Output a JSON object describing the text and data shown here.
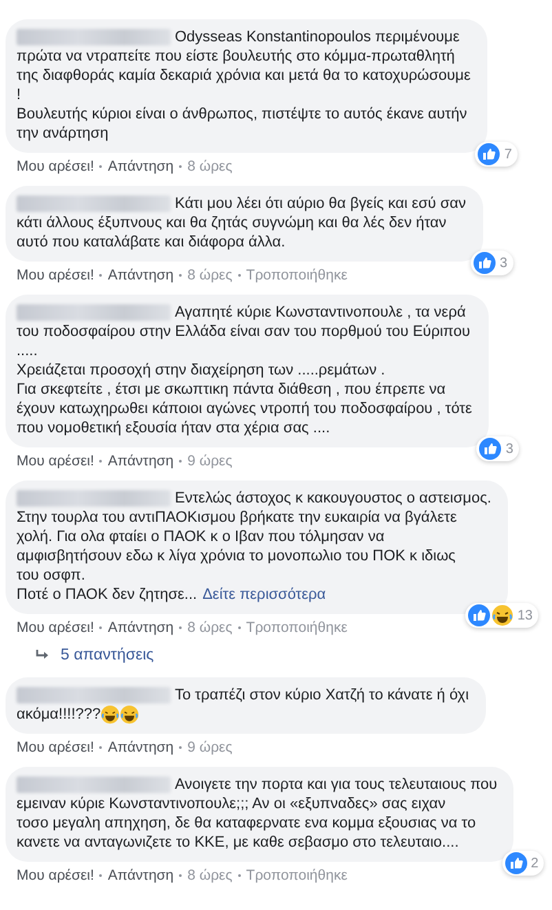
{
  "comments": [
    {
      "lines": [
        "Odysseas Konstantinopoulos περιμένουμε",
        "πρώτα να ντραπείτε που είστε βουλευτής στο κόμμα-πρωταθλητή",
        "της διαφθοράς καμία δεκαριά χρόνια και μετά θα το κατοχυρώσουμε",
        "!",
        "Βουλευτής κύριοι είναι ο άνθρωπος, πιστέψτε το αυτός έκανε αυτήν",
        "την ανάρτηση"
      ],
      "reactions": [
        {
          "kind": "like"
        }
      ],
      "reaction_count": "7",
      "actions": [
        "Μου αρέσει!",
        "Απάντηση",
        "8 ώρες"
      ]
    },
    {
      "lines": [
        "Κάτι μου λέει ότι αύριο θα βγείς και εσύ σαν",
        "κάτι άλλους έξυπνους και θα ζητάς συγνώμη και θα λές δεν ήταν",
        "αυτό που καταλάβατε και διάφορα άλλα."
      ],
      "reactions": [
        {
          "kind": "like"
        }
      ],
      "reaction_count": "3",
      "actions": [
        "Μου αρέσει!",
        "Απάντηση",
        "8 ώρες",
        "Τροποποιήθηκε"
      ]
    },
    {
      "lines": [
        "Αγαπητέ κύριε Κωνσταντινοπουλε , τα νερά",
        "του ποδοσφαίρου στην Ελλάδα είναι σαν του πορθμού του Εύριπου",
        ".....",
        "Χρειάζεται προσοχή στην διαχείρηση των .....ρεμάτων .",
        "Για σκεφτείτε , έτσι με σκωπτικη πάντα διάθεση , που έπρεπε να",
        "έχουν κατωχηρωθει κάποιοι αγώνες ντροπή του ποδοσφαίρου , τότε",
        "που νομοθετική εξουσία ήταν στα χέρια σας ...."
      ],
      "reactions": [
        {
          "kind": "like"
        }
      ],
      "reaction_count": "3",
      "actions": [
        "Μου αρέσει!",
        "Απάντηση",
        "9 ώρες"
      ]
    },
    {
      "lines": [
        "Εντελώς άστοχος κ κακουγουστος ο αστεισμος.",
        "Στην τουρλα του αντιΠΑΟΚισμου βρήκατε την ευκαιρία να βγάλετε",
        "χολή. Για ολα φταίει ο ΠΑΟΚ κ ο Ιβαν που τόλμησαν να",
        "αμφισβητήσουν εδω κ λίγα χρόνια το μονοπωλιο του ΠΟΚ κ ιδιως",
        "του οσφπ.",
        "Ποτέ ο ΠΑΟΚ δεν ζητησε..."
      ],
      "more": "Δείτε περισσότερα",
      "reactions": [
        {
          "kind": "like"
        },
        {
          "kind": "haha"
        }
      ],
      "reaction_count": "13",
      "actions": [
        "Μου αρέσει!",
        "Απάντηση",
        "8 ώρες",
        "Τροποποιήθηκε"
      ],
      "replies": "5 απαντήσεις"
    },
    {
      "lines": [
        "Το τραπέζι στον κύριο Χατζή το κάνατε ή όχι",
        "ακόμα!!!!???"
      ],
      "trailing_icons": [
        {
          "kind": "laugh"
        },
        {
          "kind": "laugh"
        }
      ],
      "actions": [
        "Μου αρέσει!",
        "Απάντηση",
        "9 ώρες"
      ]
    },
    {
      "lines": [
        "Ανοιγετε την πορτα και για τους τελευταιους που",
        "εμειναν κύριε Κωνσταντινοπουλε;;; Αν οι «εξυπναδες» σας ειχαν",
        "τοσο μεγαλη απηχηση, δε θα καταφερνατε ενα κομμα εξουσιας να το",
        "κανετε να ανταγωνιζετε το ΚΚΕ, με καθε σεβασμο στο τελευταιο...."
      ],
      "reactions": [
        {
          "kind": "like"
        }
      ],
      "reaction_count": "2",
      "actions": [
        "Μου αρέσει!",
        "Απάντηση",
        "8 ώρες",
        "Τροποποιήθηκε"
      ]
    }
  ]
}
